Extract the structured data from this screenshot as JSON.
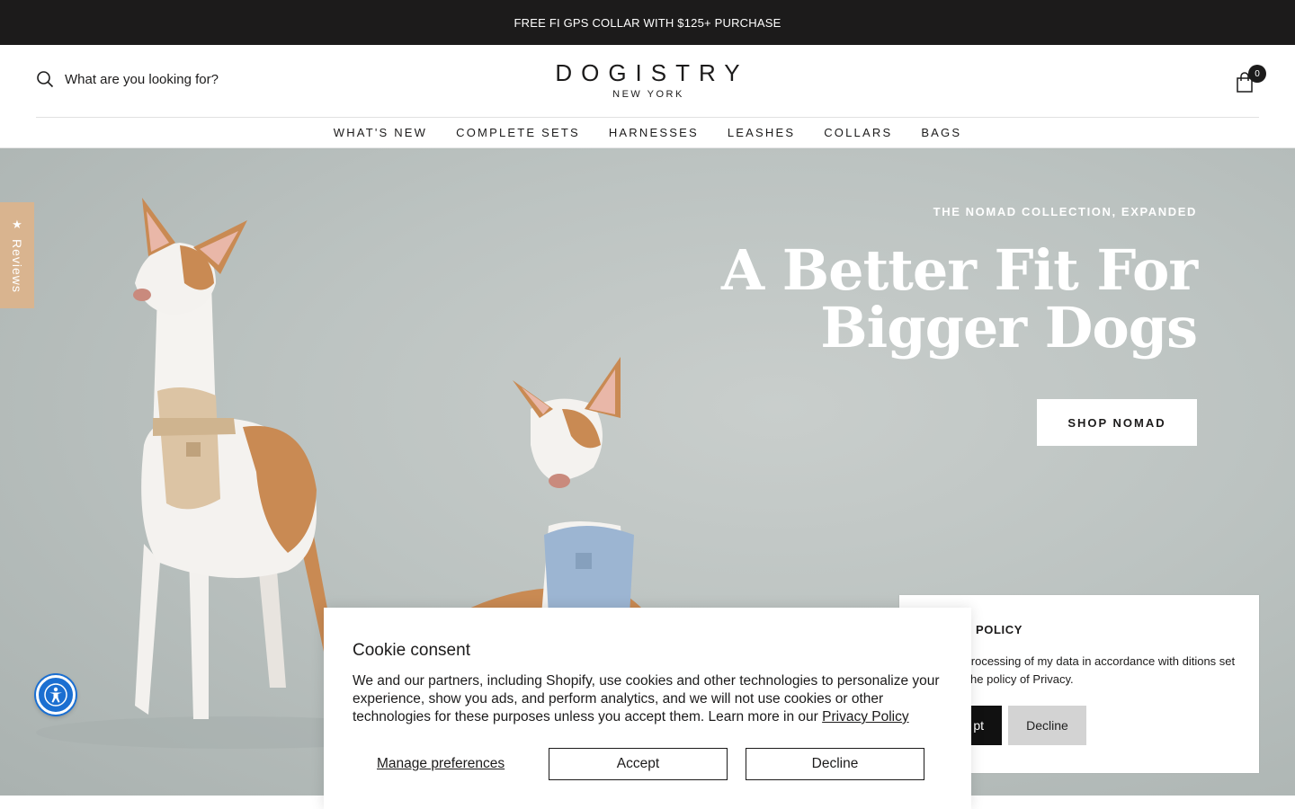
{
  "announcement": "FREE FI GPS COLLAR WITH $125+ PURCHASE",
  "header": {
    "search_placeholder": "What are you looking for?",
    "logo_main": "DOGISTRY",
    "logo_sub": "NEW YORK",
    "cart_count": "0"
  },
  "nav": {
    "items": [
      {
        "label": "WHAT'S NEW"
      },
      {
        "label": "COMPLETE SETS"
      },
      {
        "label": "HARNESSES"
      },
      {
        "label": "LEASHES"
      },
      {
        "label": "COLLARS"
      },
      {
        "label": "BAGS"
      }
    ]
  },
  "hero": {
    "eyebrow": "THE NOMAD COLLECTION, EXPANDED",
    "title": "A Better Fit For Bigger Dogs",
    "cta": "SHOP NOMAD"
  },
  "reviews_tab": {
    "label": "Reviews",
    "icon": "star-icon"
  },
  "accessibility": {
    "icon": "accessibility-icon"
  },
  "privacy_panel": {
    "title": "POLICY",
    "text": "o the processing of my data in accordance with ditions set out in the policy of Privacy.",
    "accept": "pt",
    "decline": "Decline"
  },
  "cookie": {
    "title": "Cookie consent",
    "text": "We and our partners, including Shopify, use cookies and other technologies to personalize your experience, show you ads, and perform analytics, and we will not use cookies or other technologies for these purposes unless you accept them. Learn more in our ",
    "link": "Privacy Policy",
    "manage": "Manage preferences",
    "accept": "Accept",
    "decline": "Decline"
  },
  "colors": {
    "announcement_bg": "#1c1b1b",
    "hero_bg": "#bcc3c1",
    "reviews_tab": "#d9b48f",
    "accessibility": "#1b6fd1"
  }
}
